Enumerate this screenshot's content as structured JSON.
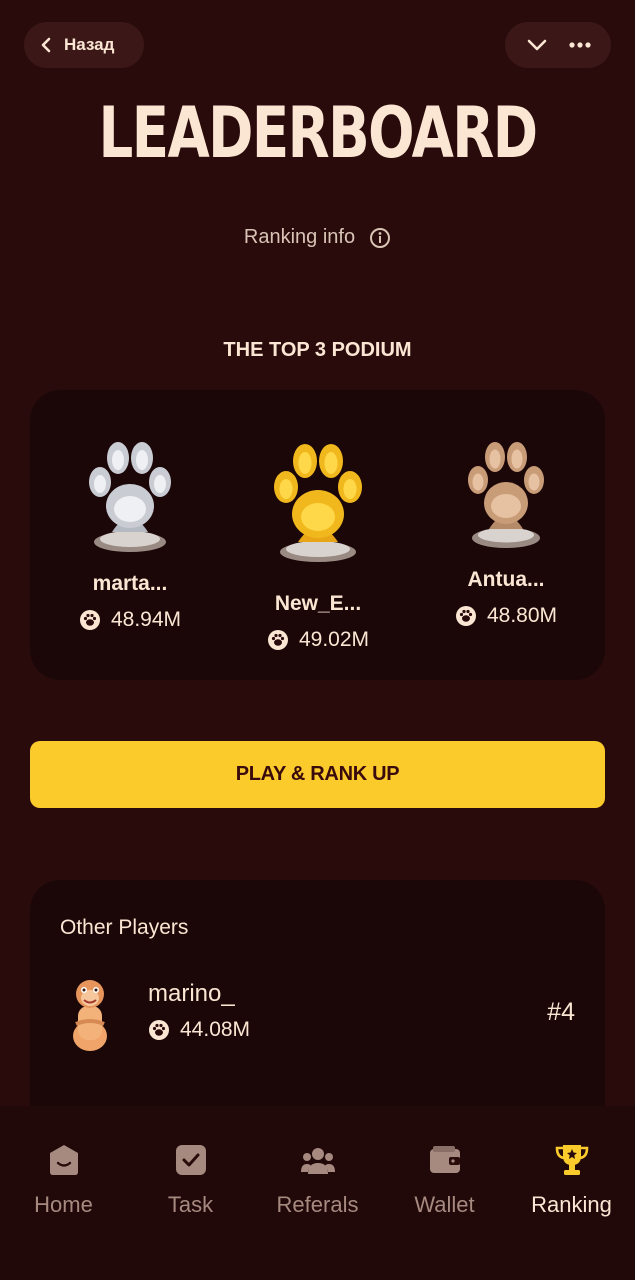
{
  "header": {
    "back_label": "Назад",
    "title": "LEADERBOARD",
    "ranking_info": "Ranking info"
  },
  "podium": {
    "title": "THE TOP 3 PODIUM",
    "second": {
      "name": "marta...",
      "score": "48.94M",
      "medal": "silver"
    },
    "first": {
      "name": "New_E...",
      "score": "49.02M",
      "medal": "gold"
    },
    "third": {
      "name": "Antua...",
      "score": "48.80M",
      "medal": "bronze"
    }
  },
  "cta": {
    "label": "PLAY & RANK UP"
  },
  "others": {
    "title": "Other Players",
    "players": [
      {
        "name": "marino_",
        "score": "44.08M",
        "rank": "#4"
      }
    ]
  },
  "nav": {
    "items": [
      {
        "label": "Home",
        "icon": "home-icon"
      },
      {
        "label": "Task",
        "icon": "task-icon"
      },
      {
        "label": "Referals",
        "icon": "referrals-icon"
      },
      {
        "label": "Wallet",
        "icon": "wallet-icon"
      },
      {
        "label": "Ranking",
        "icon": "trophy-icon",
        "active": true
      }
    ]
  },
  "colors": {
    "background": "#2a0b0c",
    "card": "#1c0708",
    "accent": "#fbcb2c",
    "text": "#fbe6d3"
  }
}
